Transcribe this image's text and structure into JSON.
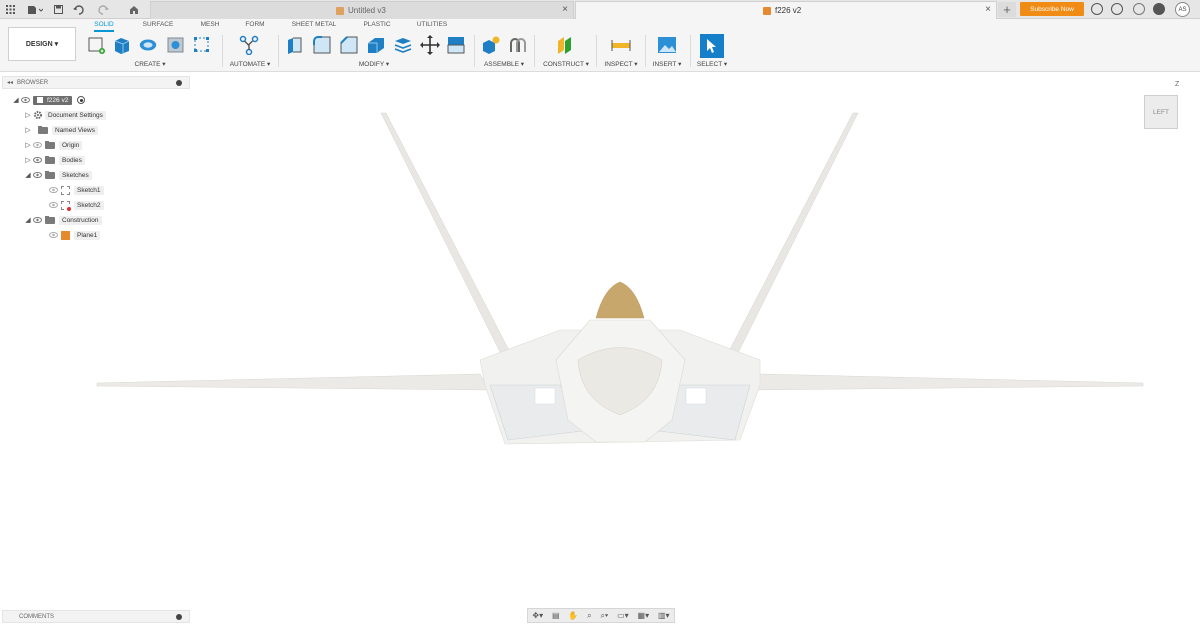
{
  "tabs": {
    "inactive_doc": "Untitled v3",
    "active_doc": "f226 v2",
    "subscribe": "Subscribe Now",
    "avatar": "AS"
  },
  "toolbar": {
    "design": "DESIGN",
    "workspace_tabs": [
      "SOLID",
      "SURFACE",
      "MESH",
      "FORM",
      "SHEET METAL",
      "PLASTIC",
      "UTILITIES"
    ],
    "groups": {
      "create": "CREATE",
      "automate": "AUTOMATE",
      "modify": "MODIFY",
      "assemble": "ASSEMBLE",
      "construct": "CONSTRUCT",
      "inspect": "INSPECT",
      "insert": "INSERT",
      "select": "SELECT"
    }
  },
  "browser": {
    "title": "BROWSER",
    "root": "f226 v2",
    "items": {
      "document_settings": "Document Settings",
      "named_views": "Named Views",
      "origin": "Origin",
      "bodies": "Bodies",
      "sketches": "Sketches",
      "sketch1": "Sketch1",
      "sketch2": "Sketch2",
      "construction": "Construction",
      "plane1": "Plane1"
    }
  },
  "comments": "COMMENTS",
  "viewcube": {
    "face": "LEFT",
    "axis": "Z"
  },
  "colors": {
    "accent": "#0696d7",
    "subscribe": "#f08c16",
    "canopy": "#c8a76c",
    "body": "#f0f0ee"
  }
}
